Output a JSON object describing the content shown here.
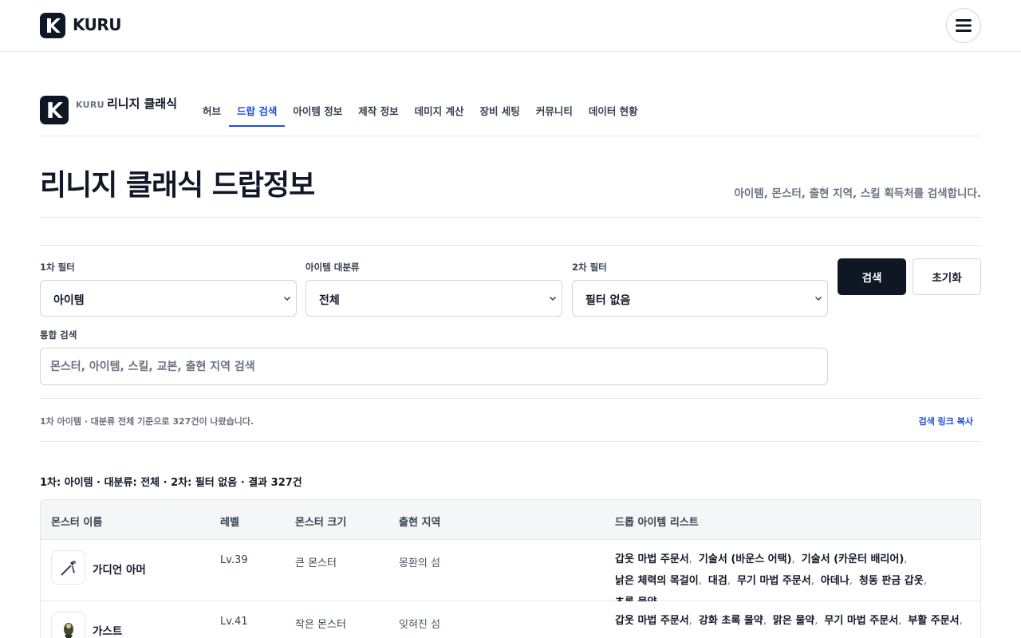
{
  "header": {
    "brand": "KURU",
    "menu_icon": "hamburger-menu-icon"
  },
  "subnav": {
    "brand_small": "KURU",
    "brand": "리니지 클래식",
    "tabs": [
      {
        "label": "허브",
        "active": false
      },
      {
        "label": "드랍 검색",
        "active": true
      },
      {
        "label": "아이템 정보",
        "active": false
      },
      {
        "label": "제작 정보",
        "active": false
      },
      {
        "label": "데미지 계산",
        "active": false
      },
      {
        "label": "장비 세팅",
        "active": false
      },
      {
        "label": "커뮤니티",
        "active": false
      },
      {
        "label": "데이터 현황",
        "active": false
      }
    ]
  },
  "page": {
    "title": "리니지 클래식 드랍정보",
    "subtitle": "아이템, 몬스터, 출현 지역, 스킬 획득처를 검색합니다."
  },
  "filters": {
    "primary": {
      "label": "1차 필터",
      "value": "아이템"
    },
    "category": {
      "label": "아이템 대분류",
      "value": "전체"
    },
    "secondary": {
      "label": "2차 필터",
      "value": "필터 없음"
    },
    "search": {
      "label": "통합 검색",
      "placeholder": "몬스터, 아이템, 스킬, 교본, 출현 지역 검색",
      "value": ""
    },
    "search_button": "검색",
    "reset_button": "초기화"
  },
  "results": {
    "note": "1차 아이템 · 대분류 전체 기준으로 327건이 나왔습니다.",
    "copy_link": "검색 링크 복사",
    "summary": "1차: 아이템 · 대분류: 전체 · 2차: 필터 없음 · 결과 327건"
  },
  "table": {
    "columns": [
      "몬스터 이름",
      "레벨",
      "몬스터 크기",
      "출현 지역",
      "드롭 아이템 리스트"
    ],
    "rows": [
      {
        "name": "가디언 아머",
        "level": "Lv.39",
        "size": "큰 몬스터",
        "region": "몽환의 섬",
        "icon": "guardian-armor-icon",
        "drops": [
          "갑옷 마법 주문서",
          "기술서 (바운스 어택)",
          "기술서 (카운터 배리어)",
          "낡은 체력의 목걸이",
          "대검",
          "무기 마법 주문서",
          "아데나",
          "청동 판금 갑옷",
          "초록 물약"
        ]
      },
      {
        "name": "가스트",
        "level": "Lv.41",
        "size": "작은 몬스터",
        "region": "잊혀진 섬",
        "icon": "ghast-icon",
        "drops": [
          "갑옷 마법 주문서",
          "강화 초록 물약",
          "맑은 물약",
          "무기 마법 주문서",
          "부활 주문서"
        ]
      }
    ]
  },
  "colors": {
    "primary_dark": "#0f1624",
    "accent_blue": "#1d4ed8",
    "border": "#e5e7eb"
  }
}
